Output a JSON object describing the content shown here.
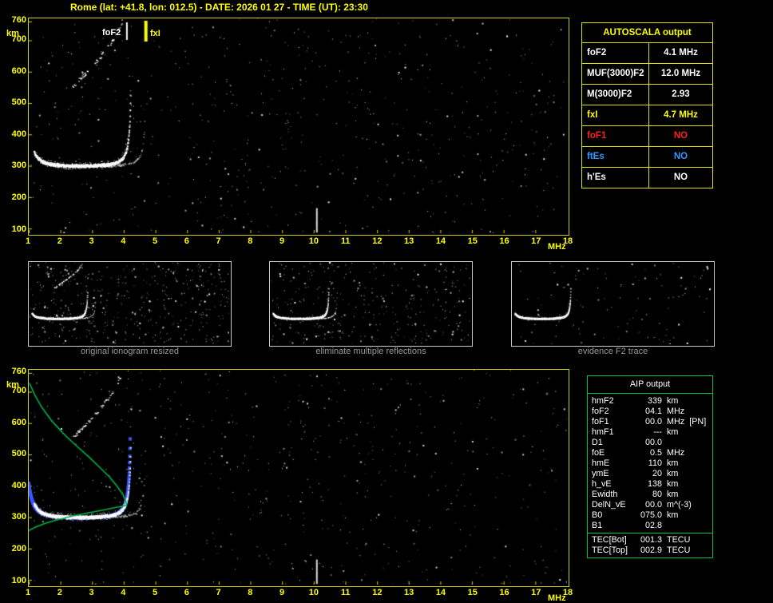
{
  "title": "Rome (lat: +41.8, lon: 012.5) - DATE: 2026 01 27 - TIME (UT): 23:30",
  "colors": {
    "axis_yellow": "#ffff00",
    "background": "#000000",
    "trace_white": "#ffffff",
    "restored_blue": "#3b58ff",
    "profile_green": "#00b44a",
    "table_yellow_border": "#e0e000",
    "aip_green_border": "#00c050",
    "no_red": "#ff2020",
    "es_blue": "#3399ff"
  },
  "autoscala_table": {
    "header": "AUTOSCALA output",
    "rows": [
      {
        "label": "foF2",
        "value": "4.1 MHz",
        "color": "#ffffff"
      },
      {
        "label": "MUF(3000)F2",
        "value": "12.0 MHz",
        "color": "#ffffff"
      },
      {
        "label": "M(3000)F2",
        "value": "2.93",
        "color": "#ffffff"
      },
      {
        "label": "fxI",
        "value": "4.7 MHz",
        "color": "#ffff00"
      },
      {
        "label": "foF1",
        "value": "NO",
        "color": "#ff2020"
      },
      {
        "label": "ftEs",
        "value": "NO",
        "color": "#3399ff"
      },
      {
        "label": "h'Es",
        "value": "NO",
        "color": "#ffffff"
      }
    ]
  },
  "thumbnails": [
    {
      "caption": "original ionogram resized"
    },
    {
      "caption": "eliminate multiple reflections"
    },
    {
      "caption": "evidence F2 trace"
    }
  ],
  "aip_table": {
    "header": "AIP output",
    "rows": [
      {
        "label": "hmF2",
        "value": "339",
        "unit": "km",
        "extra": ""
      },
      {
        "label": "foF2",
        "value": "04.1",
        "unit": "MHz",
        "extra": ""
      },
      {
        "label": "foF1",
        "value": "00.0",
        "unit": "MHz",
        "extra": "[PN]"
      },
      {
        "label": "hmF1",
        "value": "---",
        "unit": "km",
        "extra": ""
      },
      {
        "label": "D1",
        "value": "00.0",
        "unit": "",
        "extra": ""
      },
      {
        "label": "foE",
        "value": "0.5",
        "unit": "MHz",
        "extra": ""
      },
      {
        "label": "hmE",
        "value": "110",
        "unit": "km",
        "extra": ""
      },
      {
        "label": "ymE",
        "value": "20",
        "unit": "km",
        "extra": ""
      },
      {
        "label": "h_vE",
        "value": "138",
        "unit": "km",
        "extra": ""
      },
      {
        "label": "Ewidth",
        "value": "80",
        "unit": "km",
        "extra": ""
      },
      {
        "label": "DelN_vE",
        "value": "00.0",
        "unit": "m^(-3)",
        "extra": ""
      },
      {
        "label": "B0",
        "value": "075.0",
        "unit": "km",
        "extra": ""
      },
      {
        "label": "B1",
        "value": "02.8",
        "unit": "",
        "extra": ""
      }
    ],
    "tec_rows": [
      {
        "label": "TEC[Bot]",
        "value": "001.3",
        "unit": "TECU"
      },
      {
        "label": "TEC[Top]",
        "value": "002.9",
        "unit": "TECU"
      }
    ]
  },
  "chart_data": [
    {
      "name": "main_ionogram",
      "type": "scatter",
      "title": "night-time ionogram with autoscaled characteristics",
      "xlabel": "MHz",
      "ylabel": "km",
      "xlim": [
        1,
        18
      ],
      "ylim": [
        85,
        770
      ],
      "x_ticks": [
        1,
        2,
        3,
        4,
        5,
        6,
        7,
        8,
        9,
        10,
        11,
        12,
        13,
        14,
        15,
        16,
        17,
        18
      ],
      "y_ticks": [
        100,
        200,
        300,
        400,
        500,
        600,
        700,
        760
      ],
      "markers": [
        {
          "label": "foF2",
          "freq": 4.1,
          "color": "#ffffff"
        },
        {
          "label": "fxI",
          "freq": 4.7,
          "color": "#ffff00"
        }
      ],
      "f2_trace": {
        "f_start": 1.15,
        "f_critical": 4.26,
        "min_virtual_height_km": 295
      },
      "x_trace": {
        "f_start": 3.35,
        "f_critical": 4.72
      },
      "second_hop": true,
      "rfi_freq": 10.1
    },
    {
      "name": "processing_steps_thumbnails",
      "type": "scatter",
      "xlim": [
        1,
        12
      ],
      "ylim": [
        85,
        770
      ],
      "panels": [
        {
          "caption": "original ionogram resized",
          "noise": 450,
          "hop": true,
          "xmode": true
        },
        {
          "caption": "eliminate multiple reflections",
          "noise": 330,
          "hop": false,
          "xmode": true
        },
        {
          "caption": "evidence F2 trace",
          "noise": 120,
          "hop": false,
          "xmode": false
        }
      ]
    },
    {
      "name": "profile_ionogram",
      "type": "scatter",
      "title": "ionogram with restored trace and electron density profile",
      "xlabel": "MHz",
      "ylabel": "km",
      "xlim": [
        1,
        18
      ],
      "ylim": [
        85,
        770
      ],
      "x_ticks": [
        1,
        2,
        3,
        4,
        5,
        6,
        7,
        8,
        9,
        10,
        11,
        12,
        13,
        14,
        15,
        16,
        17,
        18
      ],
      "y_ticks": [
        100,
        200,
        300,
        400,
        500,
        600,
        700,
        760
      ],
      "restored_trace_color": "#3b58ff",
      "rfi_freq": 10.1,
      "profile": {
        "color": "#00b44a",
        "foF2": 4.1,
        "hmF2": 339,
        "bottomside": [
          [
            0.98,
            256
          ],
          [
            1.2,
            268
          ],
          [
            1.5,
            280
          ],
          [
            1.9,
            292
          ],
          [
            2.4,
            304
          ],
          [
            2.9,
            314
          ],
          [
            3.3,
            322
          ],
          [
            3.7,
            330
          ],
          [
            4.0,
            336
          ],
          [
            4.1,
            339
          ]
        ],
        "topside": [
          [
            4.1,
            339
          ],
          [
            4.05,
            356
          ],
          [
            3.95,
            376
          ],
          [
            3.78,
            400
          ],
          [
            3.55,
            428
          ],
          [
            3.25,
            458
          ],
          [
            2.9,
            492
          ],
          [
            2.5,
            528
          ],
          [
            2.1,
            566
          ],
          [
            1.72,
            608
          ],
          [
            1.4,
            652
          ],
          [
            1.18,
            692
          ],
          [
            1.02,
            728
          ]
        ]
      }
    }
  ]
}
